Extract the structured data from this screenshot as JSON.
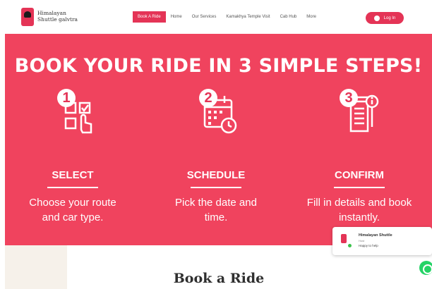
{
  "header": {
    "brand_line1": "Himalayan",
    "brand_line2": "Shuttle galvtra",
    "nav_items": [
      "Book A Ride",
      "Home",
      "Our Services",
      "Kamakhya Temple Visit",
      "Cab Hub",
      "More"
    ],
    "login_label": "Log In"
  },
  "hero": {
    "title": "BOOK YOUR RIDE IN 3 SIMPLE STEPS!",
    "steps": [
      {
        "number": "1",
        "label": "SELECT",
        "description_line1": "Choose your route",
        "description_line2": "and car type.",
        "icon": "select-checkbox-icon"
      },
      {
        "number": "2",
        "label": "SCHEDULE",
        "description_line1": "Pick the date and",
        "description_line2": "time.",
        "icon": "calendar-clock-icon"
      },
      {
        "number": "3",
        "label": "CONFIRM",
        "description_line1": "Fill in details and book",
        "description_line2": "instantly.",
        "icon": "document-info-icon"
      }
    ]
  },
  "booking": {
    "heading": "Book a Ride"
  },
  "chat": {
    "name": "Himalayan Shuttle",
    "role": "Host",
    "status": "Happy to help"
  },
  "colors": {
    "brand": "#e43456",
    "hero_bg": "#f0435e"
  }
}
